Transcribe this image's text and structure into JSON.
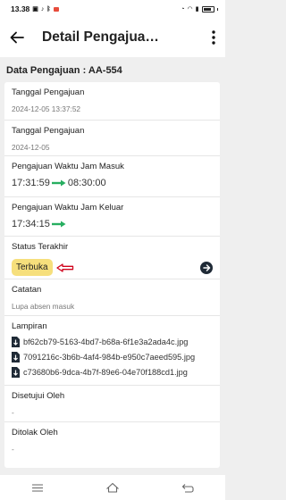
{
  "status_bar": {
    "time": "13.38",
    "badge": "Sh"
  },
  "app_bar": {
    "title": "Detail Pengajua…",
    "back_icon": "arrow-left-icon",
    "menu_icon": "more-vert-icon"
  },
  "section_title": "Data Pengajuan : AA-554",
  "fields": {
    "tanggal_pengajuan_1": {
      "label": "Tanggal Pengajuan",
      "value": "2024-12-05 13:37:52"
    },
    "tanggal_pengajuan_2": {
      "label": "Tanggal Pengajuan",
      "value": "2024-12-05"
    },
    "jam_masuk": {
      "label": "Pengajuan Waktu Jam Masuk",
      "from": "17:31:59",
      "to": "08:30:00"
    },
    "jam_keluar": {
      "label": "Pengajuan Waktu Jam Keluar",
      "from": "17:34:15",
      "to": ""
    },
    "status": {
      "label": "Status Terakhir",
      "value": "Terbuka",
      "badge_color": "#f6df7c"
    },
    "catatan": {
      "label": "Catatan",
      "value": "Lupa absen masuk"
    },
    "lampiran": {
      "label": "Lampiran",
      "files": [
        "bf62cb79-5163-4bd7-b68a-6f1e3a2ada4c.jpg",
        "7091216c-3b6b-4af4-984b-e950c7aeed595.jpg",
        "c73680b6-9dca-4b7f-89e6-04e70f188cd1.jpg"
      ]
    },
    "disetujui_oleh": {
      "label": "Disetujui Oleh",
      "value": "-"
    },
    "ditolak_oleh": {
      "label": "Ditolak Oleh",
      "value": "-"
    }
  },
  "colors": {
    "arrow_green": "#27ae60",
    "pointer_red": "#d0021b",
    "go_button": "#1f2a36"
  }
}
